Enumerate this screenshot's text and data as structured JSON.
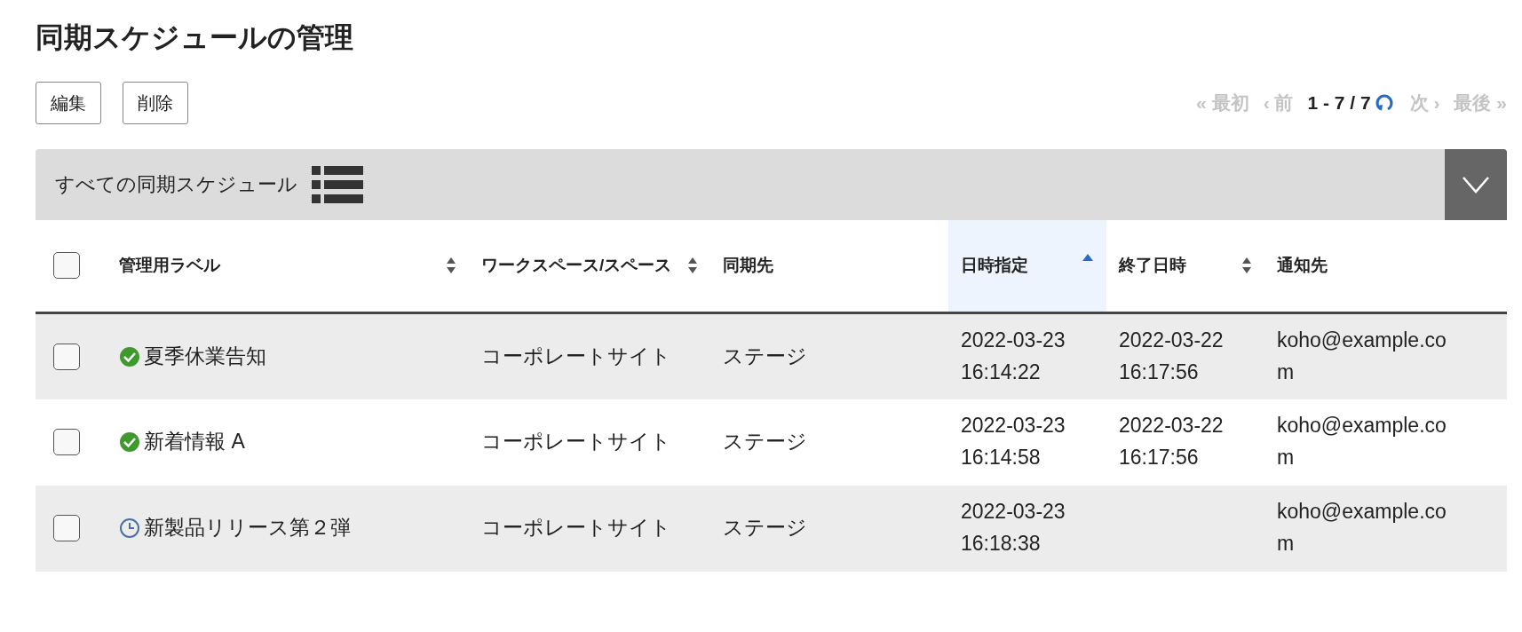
{
  "title": "同期スケジュールの管理",
  "buttons": [
    {
      "label": "編集"
    },
    {
      "label": "削除"
    }
  ],
  "pagination": {
    "first": {
      "label": "« 最初",
      "disabled": true
    },
    "prev": {
      "label": "‹ 前",
      "disabled": true
    },
    "range": "1 - 7 / 7",
    "next": {
      "label": "次 ›",
      "disabled": true
    },
    "last": {
      "label": "最後 »",
      "disabled": true
    }
  },
  "panel": {
    "title": "すべての同期スケジュール"
  },
  "table": {
    "select_all": {
      "checked": false
    },
    "columns": [
      {
        "label": "管理用ラベル",
        "sortable": true,
        "sorted": false
      },
      {
        "label": "ワークスペース/スペース",
        "sortable": true,
        "sorted": false
      },
      {
        "label": "同期先"
      },
      {
        "label": "日時指定",
        "sortable": true,
        "sorted": true
      },
      {
        "label": "終了日時",
        "sortable": true,
        "sorted": false
      },
      {
        "label": "通知先"
      }
    ],
    "rows": [
      {
        "checked": false,
        "kind": "done",
        "label": "夏季休業告知",
        "workspace": "コーポレートサイト",
        "destination": "ステージ",
        "scheduled": "2022-03-23 16:14:22",
        "end": "2022-03-22 16:17:56",
        "notify": "koho@example.com"
      },
      {
        "checked": false,
        "kind": "done",
        "label": "新着情報 A",
        "workspace": "コーポレートサイト",
        "destination": "ステージ",
        "scheduled": "2022-03-23 16:14:58",
        "end": "2022-03-22 16:17:56",
        "notify": "koho@example.com"
      },
      {
        "checked": false,
        "kind": "scheduled",
        "label": "新製品リリース第２弾",
        "workspace": "コーポレートサイト",
        "destination": "ステージ",
        "scheduled": "2022-03-23 16:18:38",
        "notify": "koho@example.com"
      }
    ]
  }
}
